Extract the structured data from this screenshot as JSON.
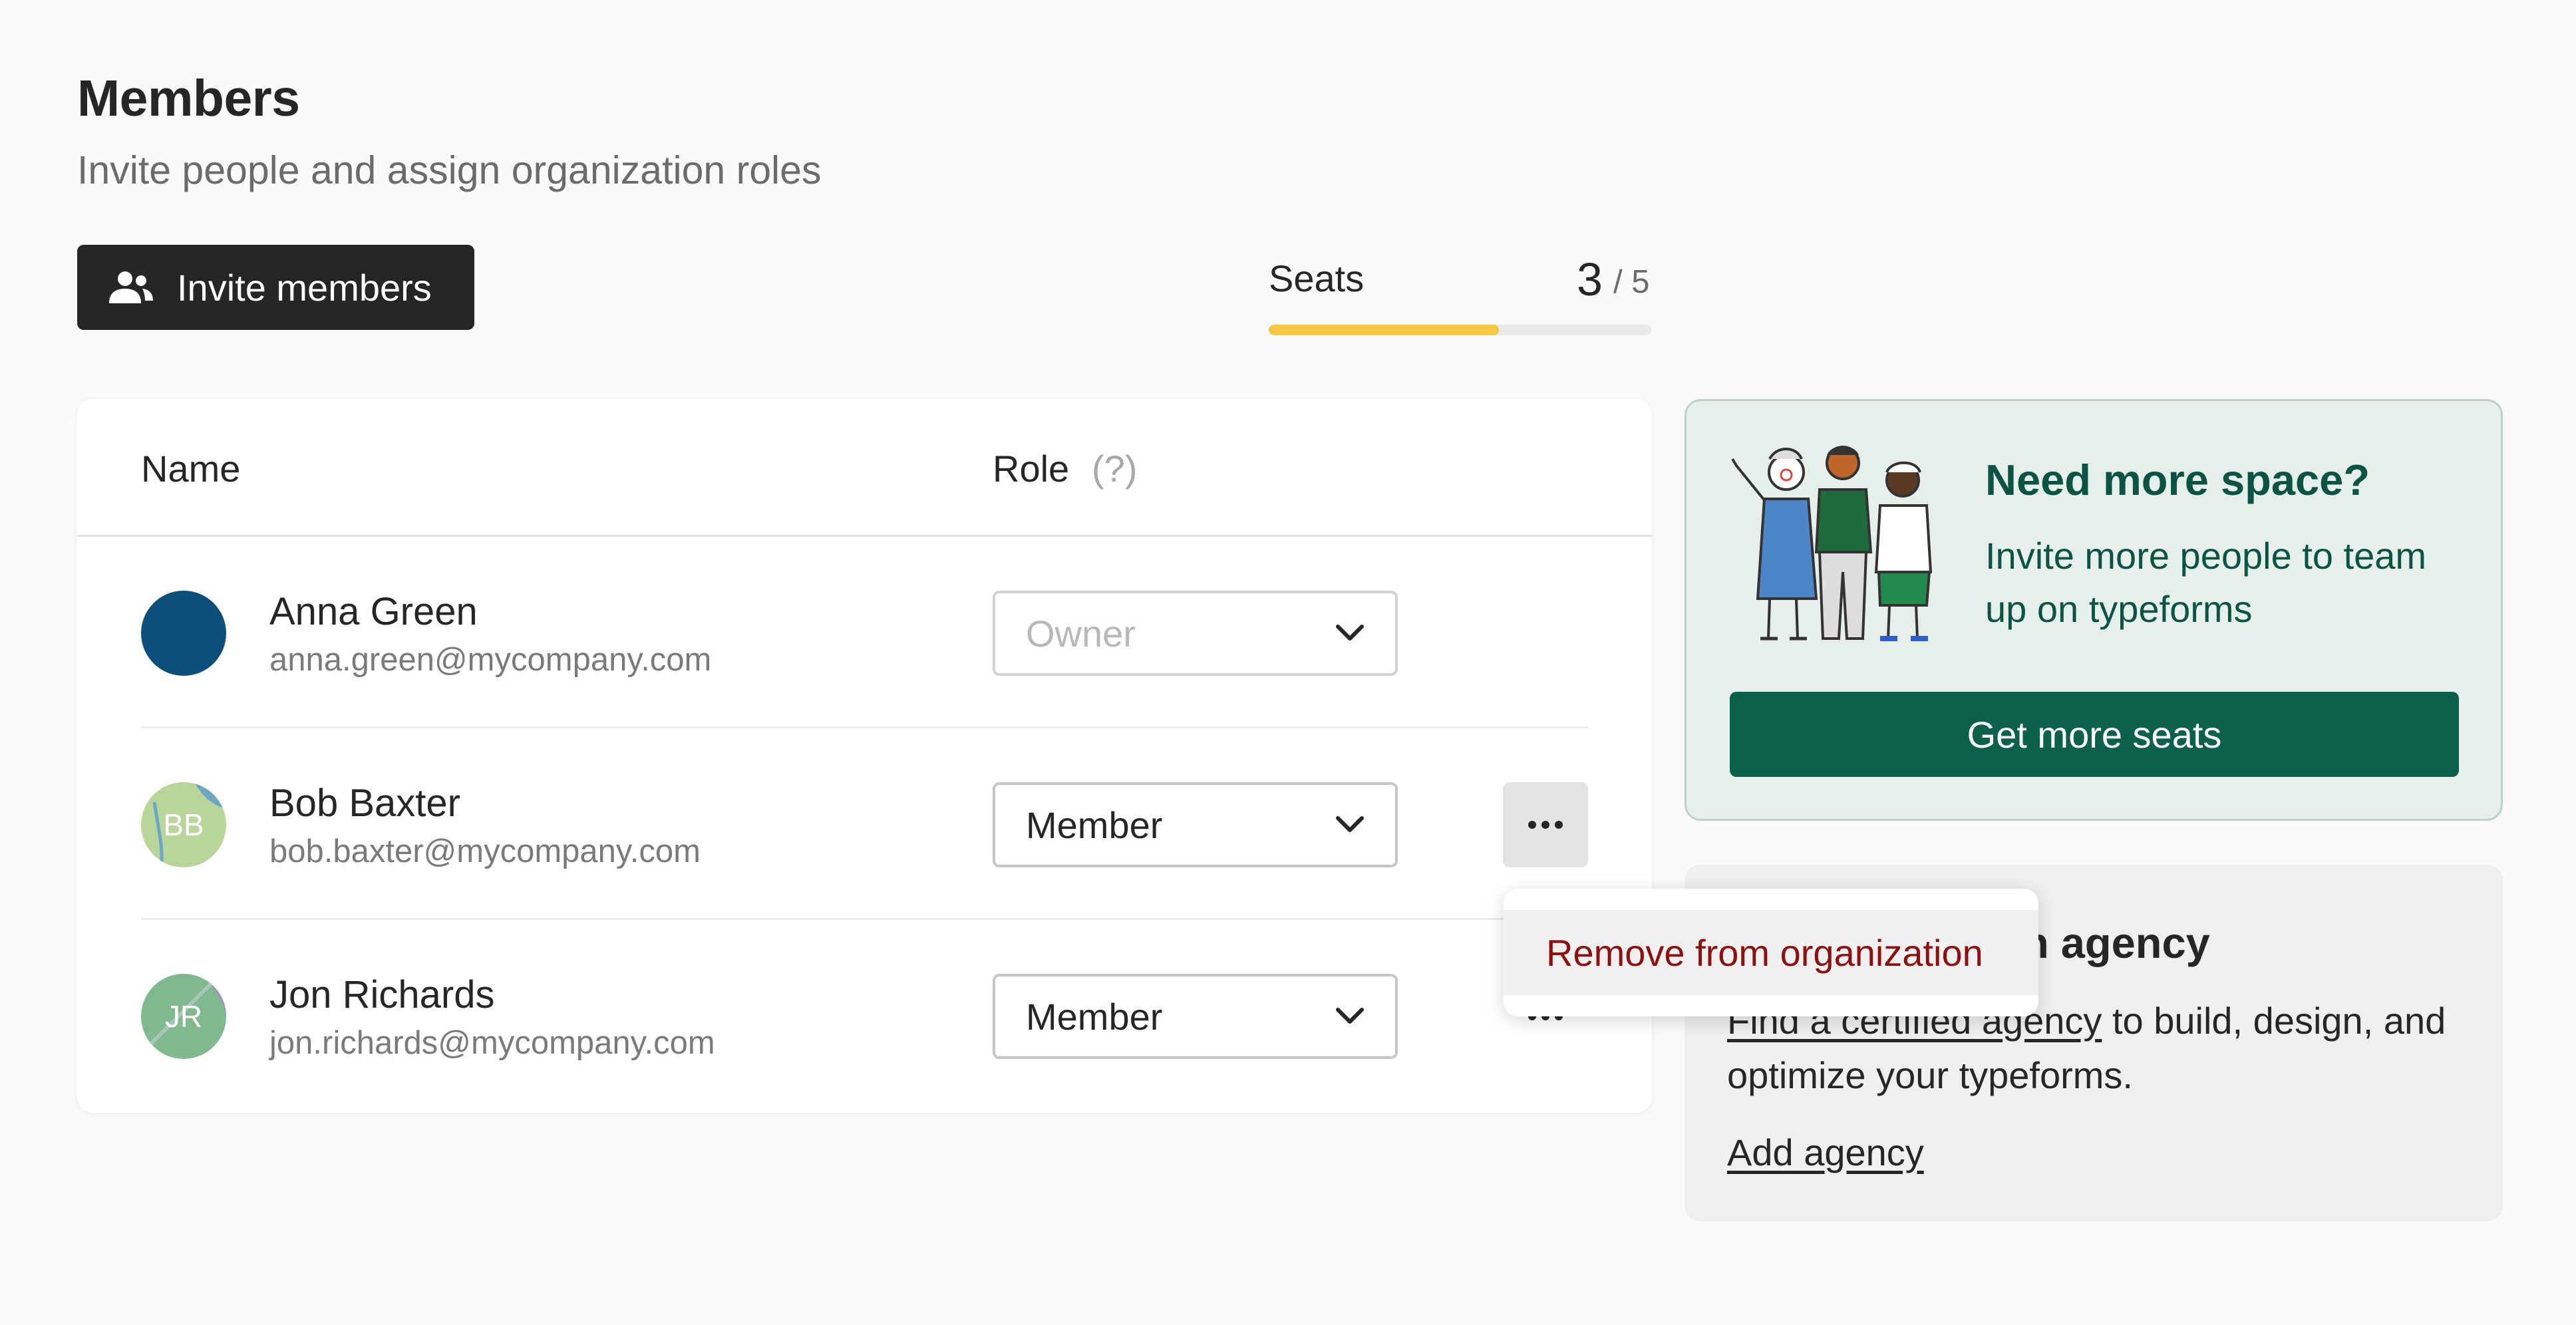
{
  "header": {
    "title": "Members",
    "subtitle": "Invite people and assign organization roles",
    "invite_label": "Invite members",
    "invite_icon": "add-person-icon"
  },
  "seats": {
    "label": "Seats",
    "used": "3",
    "total": "/ 5",
    "used_fraction": 0.6,
    "fill_color": "#f7c744"
  },
  "table": {
    "col_name": "Name",
    "col_role": "Role",
    "role_help": "(?)",
    "rows": [
      {
        "name": "Anna Green",
        "email": "anna.green@mycompany.com",
        "initials": "",
        "role": "Owner",
        "role_disabled": true,
        "avatar_color": "#0b4f7a"
      },
      {
        "name": "Bob Baxter",
        "email": "bob.baxter@mycompany.com",
        "initials": "BB",
        "role": "Member",
        "role_disabled": false,
        "avatar_color": "#b8d59a"
      },
      {
        "name": "Jon Richards",
        "email": "jon.richards@mycompany.com",
        "initials": "JR",
        "role": "Member",
        "role_disabled": false,
        "avatar_color": "#7fb98d"
      }
    ]
  },
  "menu": {
    "remove_label": "Remove from organization",
    "remove_color": "#8c1010"
  },
  "promo": {
    "title": "Need more space?",
    "text": "Invite more people to team up on typeforms",
    "button": "Get more seats",
    "accent": "#0b6149"
  },
  "agency": {
    "title_visible": "n agency",
    "link_text": "Find a certified agency",
    "text_rest": " to build, design, and optimize your typeforms.",
    "add_label": "Add agency"
  }
}
